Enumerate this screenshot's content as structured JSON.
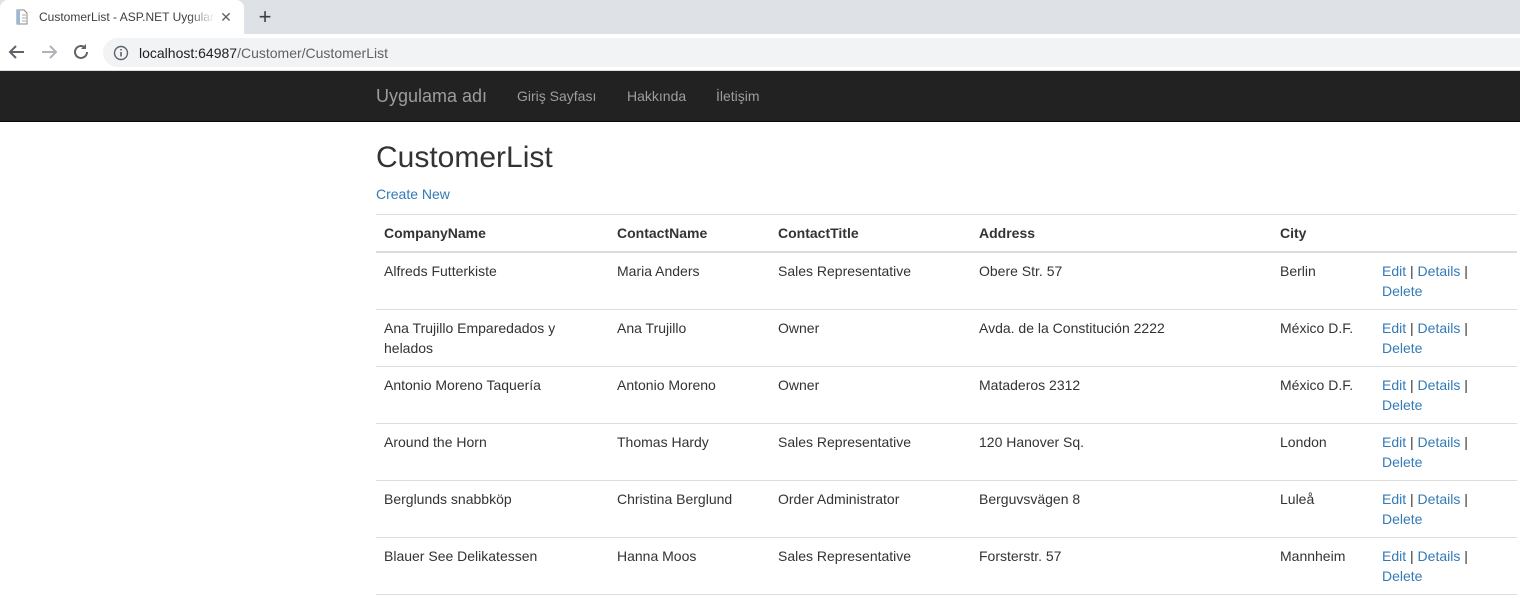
{
  "browser": {
    "tab_title": "CustomerList - ASP.NET Uygulaması",
    "url_host": "localhost:64987",
    "url_path": "/Customer/CustomerList"
  },
  "navbar": {
    "brand": "Uygulama adı",
    "links": [
      "Giriş Sayfası",
      "Hakkında",
      "İletişim"
    ]
  },
  "page": {
    "title": "CustomerList",
    "create_new": "Create New"
  },
  "table": {
    "headers": [
      "CompanyName",
      "ContactName",
      "ContactTitle",
      "Address",
      "City"
    ],
    "action_labels": {
      "edit": "Edit",
      "details": "Details",
      "delete": "Delete",
      "separator": "|"
    },
    "rows": [
      [
        "Alfreds Futterkiste",
        "Maria Anders",
        "Sales Representative",
        "Obere Str. 57",
        "Berlin"
      ],
      [
        "Ana Trujillo Emparedados y helados",
        "Ana Trujillo",
        "Owner",
        "Avda. de la Constitución 2222",
        "México D.F."
      ],
      [
        "Antonio Moreno Taquería",
        "Antonio Moreno",
        "Owner",
        "Mataderos 2312",
        "México D.F."
      ],
      [
        "Around the Horn",
        "Thomas Hardy",
        "Sales Representative",
        "120 Hanover Sq.",
        "London"
      ],
      [
        "Berglunds snabbköp",
        "Christina Berglund",
        "Order Administrator",
        "Berguvsvägen 8",
        "Luleå"
      ],
      [
        "Blauer See Delikatessen",
        "Hanna Moos",
        "Sales Representative",
        "Forsterstr. 57",
        "Mannheim"
      ]
    ]
  },
  "colors": {
    "navbar_bg": "#222222",
    "navbar_text": "#9d9d9d",
    "link": "#337ab7",
    "tabstrip_bg": "#dee1e6"
  },
  "icons": {
    "favicon": "page-icon",
    "tab_close": "close-icon",
    "new_tab": "plus-icon",
    "back": "back-arrow-icon",
    "forward": "forward-arrow-icon",
    "reload": "reload-icon",
    "site_info": "info-icon"
  }
}
